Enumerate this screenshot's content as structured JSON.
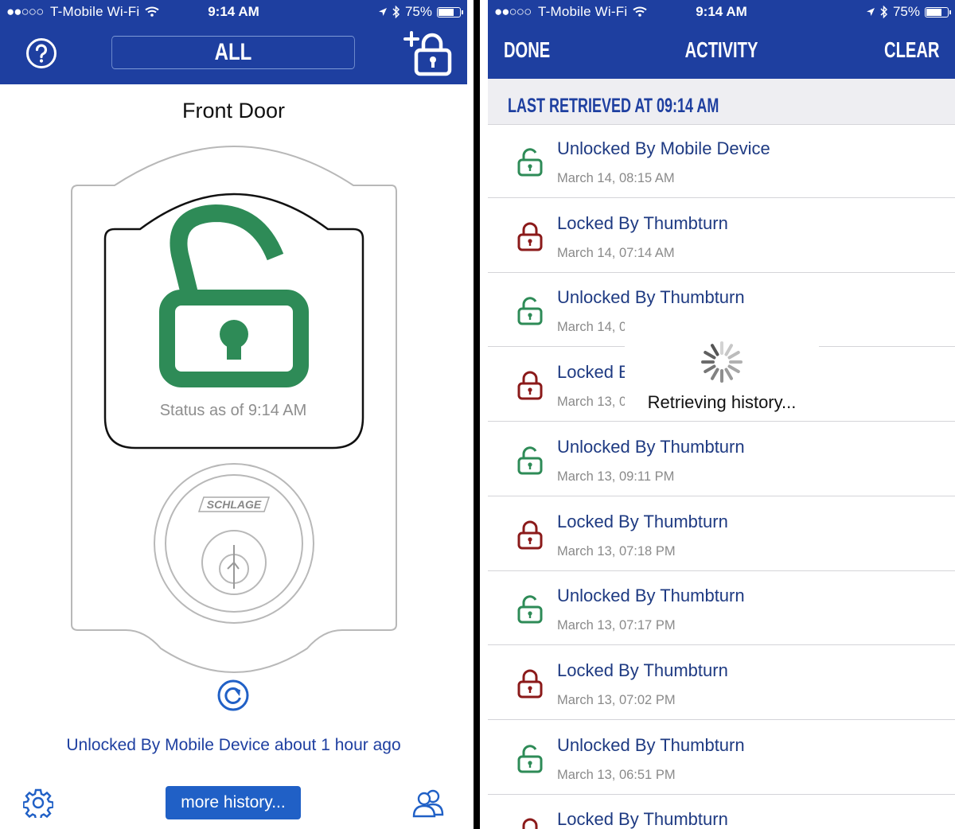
{
  "status_bar": {
    "signal": "●●○○○",
    "carrier": "T-Mobile Wi-Fi",
    "time": "9:14 AM",
    "battery": "75%",
    "battery_level": 0.75
  },
  "left": {
    "header": {
      "filter_label": "ALL"
    },
    "lock_name": "Front Door",
    "status_as_of": "Status as of 9:14 AM",
    "brand": "SCHLAGE",
    "last_event": "Unlocked By Mobile Device about 1 hour ago",
    "more_history": "more history...",
    "lock_state": "unlocked"
  },
  "right": {
    "header": {
      "done": "DONE",
      "title": "ACTIVITY",
      "clear": "CLEAR"
    },
    "last_retrieved": "LAST RETRIEVED AT 09:14 AM",
    "loading_text": "Retrieving history...",
    "entries": [
      {
        "title": "Unlocked By Mobile Device",
        "date": "March 14, 08:15 AM",
        "state": "unlocked"
      },
      {
        "title": "Locked By Thumbturn",
        "date": "March 14, 07:14 AM",
        "state": "locked"
      },
      {
        "title": "Unlocked By Thumbturn",
        "date": "March 14, 0",
        "state": "unlocked"
      },
      {
        "title": "Locked B",
        "date": "March 13, 0",
        "state": "locked"
      },
      {
        "title": "Unlocked By Thumbturn",
        "date": "March 13, 09:11 PM",
        "state": "unlocked"
      },
      {
        "title": "Locked By Thumbturn",
        "date": "March 13, 07:18 PM",
        "state": "locked"
      },
      {
        "title": "Unlocked By Thumbturn",
        "date": "March 13, 07:17 PM",
        "state": "unlocked"
      },
      {
        "title": "Locked By Thumbturn",
        "date": "March 13, 07:02 PM",
        "state": "locked"
      },
      {
        "title": "Unlocked By Thumbturn",
        "date": "March 13, 06:51 PM",
        "state": "unlocked"
      },
      {
        "title": "Locked By Thumbturn",
        "date": "",
        "state": "locked"
      }
    ]
  },
  "colors": {
    "brand_blue": "#1e3fa0",
    "unlocked_green": "#2e8b57",
    "locked_red": "#8b1a1a",
    "button_blue": "#2060c6"
  }
}
